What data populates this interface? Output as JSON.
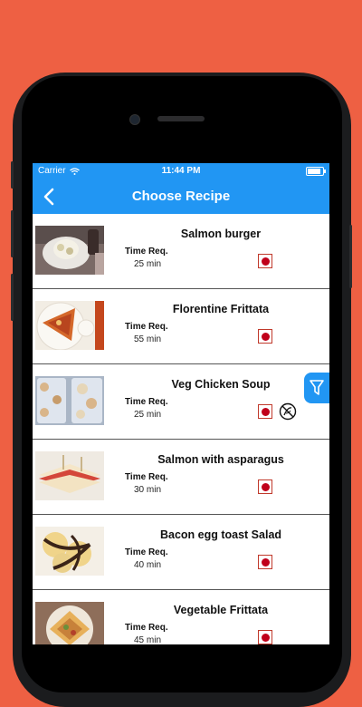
{
  "status_bar": {
    "carrier": "Carrier",
    "time": "11:44 PM"
  },
  "nav": {
    "title": "Choose Recipe"
  },
  "colors": {
    "background": "#EE6043",
    "accent": "#2196F3",
    "badge_dot": "#C0001A"
  },
  "recipes": [
    {
      "name": "Salmon burger",
      "time_label": "Time Req.",
      "time": "25 min",
      "icons": [
        "non-veg-icon"
      ]
    },
    {
      "name": "Florentine Frittata",
      "time_label": "Time Req.",
      "time": "55 min",
      "icons": [
        "non-veg-icon"
      ]
    },
    {
      "name": "Veg Chicken Soup",
      "time_label": "Time Req.",
      "time": "25 min",
      "icons": [
        "non-veg-icon",
        "no-veg-icon"
      ]
    },
    {
      "name": "Salmon with asparagus",
      "time_label": "Time Req.",
      "time": "30 min",
      "icons": [
        "non-veg-icon"
      ]
    },
    {
      "name": "Bacon egg toast Salad",
      "time_label": "Time Req.",
      "time": "40 min",
      "icons": [
        "non-veg-icon"
      ]
    },
    {
      "name": "Vegetable Frittata",
      "time_label": "Time Req.",
      "time": "45 min",
      "icons": [
        "non-veg-icon"
      ]
    }
  ],
  "icons": {
    "back": "chevron-left-icon",
    "filter": "filter-icon",
    "wifi": "wifi-icon",
    "battery": "battery-icon"
  }
}
